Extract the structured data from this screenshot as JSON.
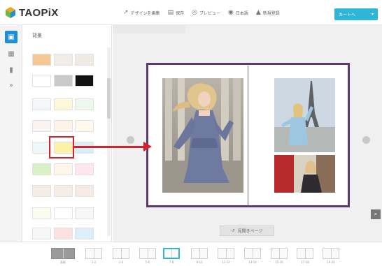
{
  "app": {
    "logo_text": "TAOPiX",
    "colors": {
      "accent": "#1e8fd6",
      "order_button": "#2fb5d6",
      "spread_border": "#5b3a73",
      "annotation": "#d9212e"
    }
  },
  "toolbar": {
    "actions": [
      {
        "icon": "edit-design-icon",
        "glyph": "↗",
        "label": "デザインを編集"
      },
      {
        "icon": "save-icon",
        "glyph": "▤",
        "label": "保存"
      },
      {
        "icon": "preview-icon",
        "glyph": "◎",
        "label": "プレビュー"
      },
      {
        "icon": "language-icon",
        "glyph": "◉",
        "label": "日本語"
      },
      {
        "icon": "account-icon",
        "glyph": "▲",
        "label": "新規登録"
      }
    ],
    "order_label": "カートへ",
    "order_chevron": "▾"
  },
  "rail": {
    "icons": [
      "layout-icon",
      "photos-icon",
      "trash-icon",
      "expand-icon"
    ],
    "glyphs": [
      "▣",
      "▦",
      "▮",
      "»"
    ]
  },
  "panel": {
    "title": "背景"
  },
  "canvas": {
    "page_label": "見開きページ",
    "page_label_icon": "↺",
    "zoom_glyph": "⌕"
  },
  "page_strip": {
    "labels": [
      "表紙",
      "1-2",
      "3-4",
      "5-6",
      "7-8",
      "9-10",
      "11-12",
      "13-14",
      "15-16",
      "17-18",
      "19-20"
    ],
    "active_index": 4
  }
}
